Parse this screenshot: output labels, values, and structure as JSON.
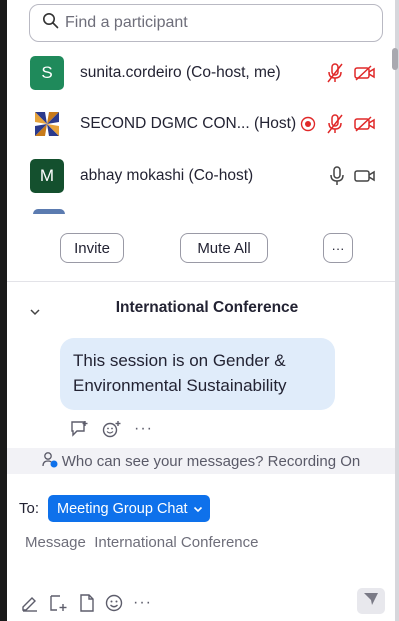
{
  "search": {
    "placeholder": "Find a participant"
  },
  "participants": [
    {
      "avatar_text": "S",
      "avatar_color": "#1f8a5b",
      "name": "sunita.cordeiro (Co-host, me)",
      "mic": "muted",
      "video": "off"
    },
    {
      "avatar_text": "",
      "avatar_type": "logo",
      "name": "SECOND DGMC CON... (Host)",
      "recording": true,
      "mic": "muted",
      "video": "off"
    },
    {
      "avatar_text": "M",
      "avatar_color": "#14502e",
      "name": "abhay mokashi (Co-host)",
      "mic": "on",
      "video": "on"
    }
  ],
  "actions": {
    "invite": "Invite",
    "mute_all": "Mute All",
    "more": "···"
  },
  "chat": {
    "title": "International Conference",
    "message": "This session is on Gender & Environmental Sustainability",
    "reaction_more": "···",
    "visibility_notice": "Who can see your messages? Recording On",
    "to_label": "To:",
    "to_value": "Meeting Group Chat",
    "input_placeholder": "Message  International Conference",
    "toolbar_more": "···"
  },
  "colors": {
    "accent": "#0e71eb",
    "muted_red": "#e02828",
    "bubble": "#e0ecfa"
  }
}
